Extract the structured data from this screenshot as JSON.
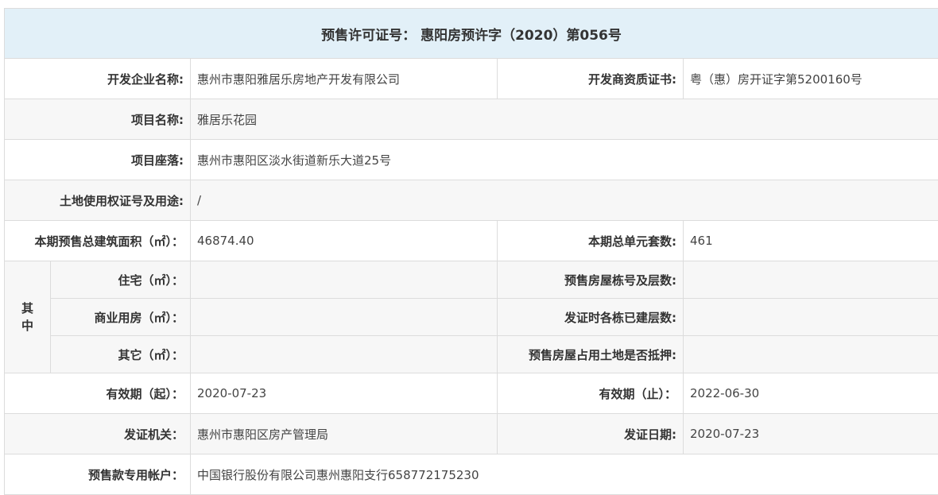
{
  "title": {
    "label": "预售许可证号：",
    "value": "惠阳房预许字（2020）第056号"
  },
  "rows": {
    "developer": {
      "label": "开发企业名称:",
      "value": "惠州市惠阳雅居乐房地产开发有限公司"
    },
    "qualification": {
      "label": "开发商资质证书:",
      "value": "粤（惠）房开证字第5200160号"
    },
    "project_name": {
      "label": "项目名称:",
      "value": "雅居乐花园"
    },
    "project_location": {
      "label": "项目座落:",
      "value": "惠州市惠阳区淡水街道新乐大道25号"
    },
    "land_use": {
      "label": "土地使用权证号及用途:",
      "value": "/"
    },
    "total_area": {
      "label": "本期预售总建筑面积（㎡）：",
      "value": "46874.40"
    },
    "total_units": {
      "label": "本期总单元套数:",
      "value": "461"
    },
    "of_which": {
      "char1": "其",
      "char2": "中"
    },
    "residential": {
      "label": "住宅（㎡）：",
      "value": ""
    },
    "building_floors": {
      "label": "预售房屋栋号及层数:",
      "value": ""
    },
    "commercial": {
      "label": "商业用房（㎡）：",
      "value": ""
    },
    "built_floors": {
      "label": "发证时各栋已建层数:",
      "value": ""
    },
    "other": {
      "label": "其它（㎡）：",
      "value": ""
    },
    "mortgage": {
      "label": "预售房屋占用土地是否抵押:",
      "value": ""
    },
    "valid_from": {
      "label": "有效期（起）：",
      "value": "2020-07-23"
    },
    "valid_to": {
      "label": "有效期（止）：",
      "value": "2022-06-30"
    },
    "issuer": {
      "label": "发证机关：",
      "value": "惠州市惠阳区房产管理局"
    },
    "issue_date": {
      "label": "发证日期:",
      "value": "2020-07-23"
    },
    "account": {
      "label": "预售款专用帐户：",
      "value": "中国银行股份有限公司惠州惠阳支行658772175230"
    }
  }
}
